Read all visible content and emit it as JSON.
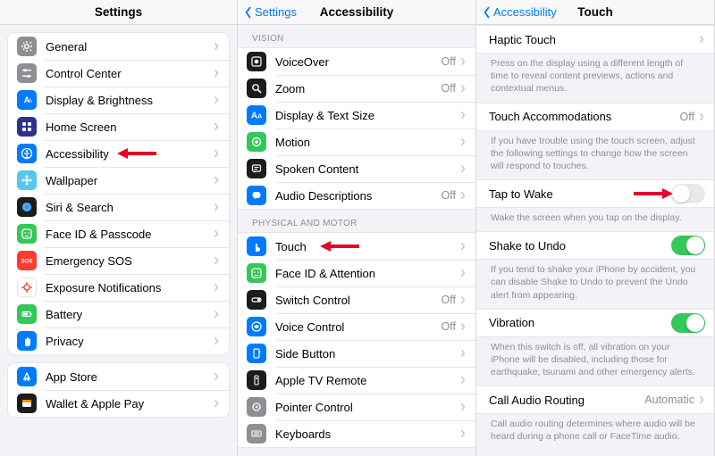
{
  "col1": {
    "title": "Settings",
    "groups": [
      {
        "items": [
          {
            "id": "general",
            "label": "General",
            "icon": "gear",
            "color": "#8e8e93"
          },
          {
            "id": "control-center",
            "label": "Control Center",
            "icon": "sliders",
            "color": "#8e8e93"
          },
          {
            "id": "display",
            "label": "Display & Brightness",
            "icon": "sun",
            "color": "#007aff"
          },
          {
            "id": "home-screen",
            "label": "Home Screen",
            "icon": "grid",
            "color": "#2e3192"
          },
          {
            "id": "accessibility",
            "label": "Accessibility",
            "icon": "person",
            "color": "#007aff",
            "arrow": true
          },
          {
            "id": "wallpaper",
            "label": "Wallpaper",
            "icon": "flower",
            "color": "#54c7ec"
          },
          {
            "id": "siri",
            "label": "Siri & Search",
            "icon": "siri",
            "color": "#1c1c1e"
          },
          {
            "id": "faceid",
            "label": "Face ID & Passcode",
            "icon": "face",
            "color": "#34c759"
          },
          {
            "id": "sos",
            "label": "Emergency SOS",
            "icon": "sos",
            "color": "#ff3b30"
          },
          {
            "id": "exposure",
            "label": "Exposure Notifications",
            "icon": "virus",
            "color": "#ffffff",
            "fg": "#ff3b30",
            "border": true
          },
          {
            "id": "battery",
            "label": "Battery",
            "icon": "battery",
            "color": "#34c759"
          },
          {
            "id": "privacy",
            "label": "Privacy",
            "icon": "hand",
            "color": "#007aff"
          }
        ]
      },
      {
        "items": [
          {
            "id": "app-store",
            "label": "App Store",
            "icon": "appstore",
            "color": "#007aff"
          },
          {
            "id": "wallet",
            "label": "Wallet & Apple Pay",
            "icon": "wallet",
            "color": "#1c1c1e"
          }
        ]
      }
    ]
  },
  "col2": {
    "back": "Settings",
    "title": "Accessibility",
    "section_vision": "VISION",
    "section_motor": "PHYSICAL AND MOTOR",
    "vision_items": [
      {
        "id": "voiceover",
        "label": "VoiceOver",
        "icon": "voiceover",
        "color": "#1c1c1e",
        "value": "Off"
      },
      {
        "id": "zoom",
        "label": "Zoom",
        "icon": "zoom",
        "color": "#1c1c1e",
        "value": "Off"
      },
      {
        "id": "text-size",
        "label": "Display & Text Size",
        "icon": "aa",
        "color": "#007aff"
      },
      {
        "id": "motion",
        "label": "Motion",
        "icon": "motion",
        "color": "#34c759"
      },
      {
        "id": "spoken",
        "label": "Spoken Content",
        "icon": "speak",
        "color": "#1c1c1e"
      },
      {
        "id": "audio-desc",
        "label": "Audio Descriptions",
        "icon": "bubble",
        "color": "#007aff",
        "value": "Off"
      }
    ],
    "motor_items": [
      {
        "id": "touch",
        "label": "Touch",
        "icon": "touch",
        "color": "#007aff",
        "arrow": true
      },
      {
        "id": "face-attention",
        "label": "Face ID & Attention",
        "icon": "face",
        "color": "#34c759"
      },
      {
        "id": "switch-control",
        "label": "Switch Control",
        "icon": "switch",
        "color": "#1c1c1e",
        "value": "Off"
      },
      {
        "id": "voice-control",
        "label": "Voice Control",
        "icon": "voicectl",
        "color": "#007aff",
        "value": "Off"
      },
      {
        "id": "side-button",
        "label": "Side Button",
        "icon": "side",
        "color": "#007aff"
      },
      {
        "id": "apple-tv",
        "label": "Apple TV Remote",
        "icon": "remote",
        "color": "#1c1c1e"
      },
      {
        "id": "pointer",
        "label": "Pointer Control",
        "icon": "pointer",
        "color": "#8e8e93"
      },
      {
        "id": "keyboards",
        "label": "Keyboards",
        "icon": "keyboard",
        "color": "#8e8e93"
      }
    ]
  },
  "col3": {
    "back": "Accessibility",
    "title": "Touch",
    "rows": [
      {
        "type": "link",
        "id": "haptic-touch",
        "label": "Haptic Touch"
      },
      {
        "type": "footer",
        "text": "Press on the display using a different length of time to reveal content previews, actions and contextual menus."
      },
      {
        "type": "link",
        "id": "touch-accom",
        "label": "Touch Accommodations",
        "value": "Off"
      },
      {
        "type": "footer",
        "text": "If you have trouble using the touch screen, adjust the following settings to change how the screen will respond to touches."
      },
      {
        "type": "toggle",
        "id": "tap-to-wake",
        "label": "Tap to Wake",
        "on": false,
        "arrow": true
      },
      {
        "type": "footer",
        "text": "Wake the screen when you tap on the display."
      },
      {
        "type": "toggle",
        "id": "shake-to-undo",
        "label": "Shake to Undo",
        "on": true
      },
      {
        "type": "footer",
        "text": "If you tend to shake your iPhone by accident, you can disable Shake to Undo to prevent the Undo alert from appearing."
      },
      {
        "type": "toggle",
        "id": "vibration",
        "label": "Vibration",
        "on": true
      },
      {
        "type": "footer",
        "text": "When this switch is off, all vibration on your iPhone will be disabled, including those for earthquake, tsunami and other emergency alerts."
      },
      {
        "type": "link",
        "id": "call-audio",
        "label": "Call Audio Routing",
        "value": "Automatic"
      },
      {
        "type": "footer",
        "text": "Call audio routing determines where audio will be heard during a phone call or FaceTime audio."
      }
    ]
  }
}
